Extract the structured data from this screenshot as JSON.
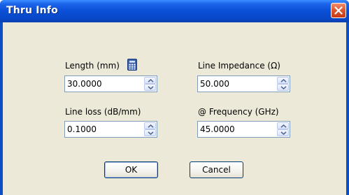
{
  "window": {
    "title": "Thru Info"
  },
  "fields": {
    "length": {
      "label": "Length (mm)",
      "value": "30.0000"
    },
    "line_impedance": {
      "label": "Line Impedance (Ω)",
      "value": "50.000"
    },
    "line_loss": {
      "label": "Line loss (dB/mm)",
      "value": "0.1000"
    },
    "frequency": {
      "label": "@ Frequency (GHz)",
      "value": "45.0000"
    }
  },
  "buttons": {
    "ok": "OK",
    "cancel": "Cancel"
  },
  "icons": {
    "calculator": "calculator-icon",
    "close": "close-icon",
    "spin_up": "chevron-up-icon",
    "spin_down": "chevron-down-icon"
  },
  "colors": {
    "titlebar": "#0a4fd6",
    "client_background": "#ece9d8",
    "close_button": "#e0572f",
    "field_border": "#7f9db9",
    "button_border": "#003c74"
  }
}
